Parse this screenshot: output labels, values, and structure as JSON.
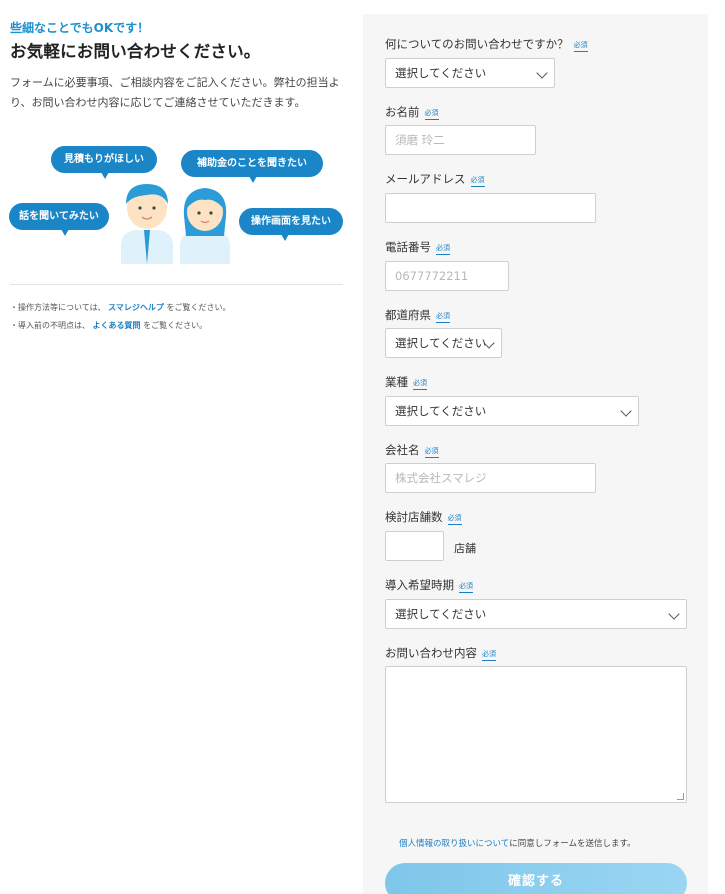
{
  "left": {
    "tagline": "些細なことでもOKです！",
    "headline": "お気軽にお問い合わせください。",
    "intro": "フォームに必要事項、ご相談内容をご記入ください。弊社の担当より、お問い合わせ内容に応じてご連絡させていただきます。",
    "bubbles": [
      "見積もりがほしい",
      "補助金のことを聞きたい",
      "話を聞いてみたい",
      "操作画面を見たい"
    ],
    "notes": [
      {
        "prefix": "・操作方法等については、",
        "link": "スマレジヘルプ",
        "suffix": "をご覧ください。"
      },
      {
        "prefix": "・導入前の不明点は、",
        "link": "よくある質問",
        "suffix": "をご覧ください。"
      }
    ]
  },
  "form": {
    "required_label": "必須",
    "inquiry_about": {
      "label": "何についてのお問い合わせですか？",
      "value": "選択してください"
    },
    "name": {
      "label": "お名前",
      "placeholder": "須磨 玲二"
    },
    "email": {
      "label": "メールアドレス",
      "placeholder": ""
    },
    "phone": {
      "label": "電話番号",
      "placeholder": "0677772211"
    },
    "prefecture": {
      "label": "都道府県",
      "value": "選択してください"
    },
    "industry": {
      "label": "業種",
      "value": "選択してください"
    },
    "company": {
      "label": "会社名",
      "placeholder": "株式会社スマレジ"
    },
    "stores": {
      "label": "検討店舗数",
      "unit": "店舗"
    },
    "timing": {
      "label": "導入希望時期",
      "value": "選択してください"
    },
    "message": {
      "label": "お問い合わせ内容"
    },
    "consent": {
      "link": "個人情報の取り扱いについて",
      "text": "に同意しフォームを送信します。"
    },
    "submit": "確認する"
  },
  "colors": {
    "accent": "#1d8fcf",
    "bubble": "#1a86c7",
    "panel": "#f6f6f6",
    "button": "#8fd0ee"
  }
}
